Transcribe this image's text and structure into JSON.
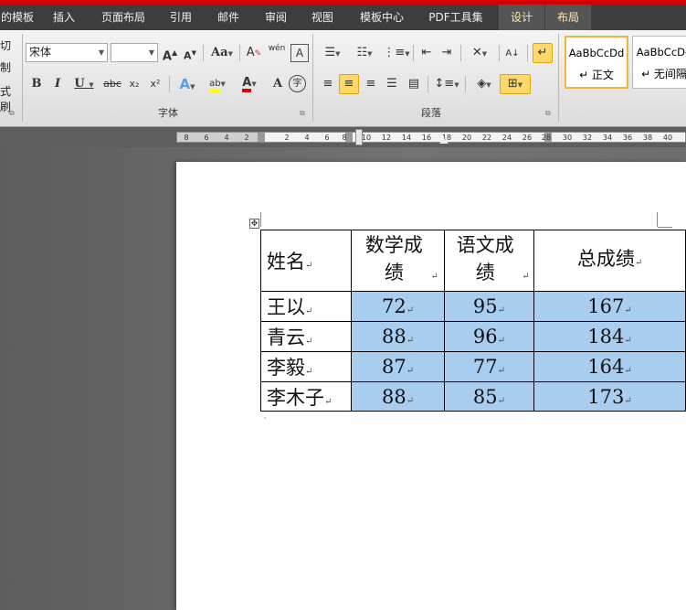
{
  "tabs": [
    {
      "id": "template",
      "label": "的模板"
    },
    {
      "id": "insert",
      "label": "插入"
    },
    {
      "id": "layout",
      "label": "页面布局"
    },
    {
      "id": "references",
      "label": "引用"
    },
    {
      "id": "mailings",
      "label": "邮件"
    },
    {
      "id": "review",
      "label": "审阅"
    },
    {
      "id": "view",
      "label": "视图"
    },
    {
      "id": "template_center",
      "label": "模板中心"
    },
    {
      "id": "pdf",
      "label": "PDF工具集"
    },
    {
      "id": "design",
      "label": "设计"
    },
    {
      "id": "table_layout",
      "label": "布局"
    }
  ],
  "clipboard": {
    "frag1": "切",
    "frag2": "制",
    "frag3": "式刷"
  },
  "font": {
    "name_value": "宋体",
    "size_value": "",
    "group_label": "字体",
    "grow_label": "A",
    "shrink_label": "A",
    "case_label": "Aa",
    "clear_label": "A",
    "phonetic_label": "wén",
    "border_char_label": "A",
    "bold_label": "B",
    "italic_label": "I",
    "underline_label": "U",
    "strike_label": "abc",
    "subscript_label": "x₂",
    "superscript_label": "x²",
    "effects_label": "A",
    "highlight_label": "ab",
    "font_color_label": "A",
    "char_shading_label": "A",
    "enclose_label": "字"
  },
  "paragraph": {
    "group_label": "段落"
  },
  "styles": [
    {
      "sample": "AaBbCcDd",
      "name": "↵ 正文",
      "selected": true
    },
    {
      "sample": "AaBbCcDd",
      "name": "↵ 无间隔",
      "selected": false
    }
  ],
  "ruler": {
    "left_numbers": [
      "8",
      "6",
      "4",
      "2"
    ],
    "right_numbers": [
      "2",
      "4",
      "6",
      "8",
      "10",
      "12",
      "14",
      "16",
      "18",
      "20",
      "22",
      "24",
      "26",
      "28",
      "30",
      "32",
      "34",
      "36",
      "38",
      "40"
    ]
  },
  "table": {
    "header": {
      "name": "姓名",
      "math": "数学成绩",
      "chinese": "语文成绩",
      "total": "总成绩"
    },
    "rows": [
      {
        "name": "王以",
        "math": "72",
        "chinese": "95",
        "total": "167"
      },
      {
        "name": "青云",
        "math": "88",
        "chinese": "96",
        "total": "184"
      },
      {
        "name": "李毅",
        "math": "87",
        "chinese": "77",
        "total": "164"
      },
      {
        "name": "李木子",
        "math": "88",
        "chinese": "85",
        "total": "173"
      }
    ],
    "highlight_color": "#a9cdef"
  },
  "paragraph_mark": "↵",
  "colors": {
    "accent_red": "#d60000",
    "tab_bar": "#3d3d3d",
    "highlight_yellow": "#ffff00",
    "font_red": "#e00000",
    "style_selected": "#f2b43c"
  }
}
